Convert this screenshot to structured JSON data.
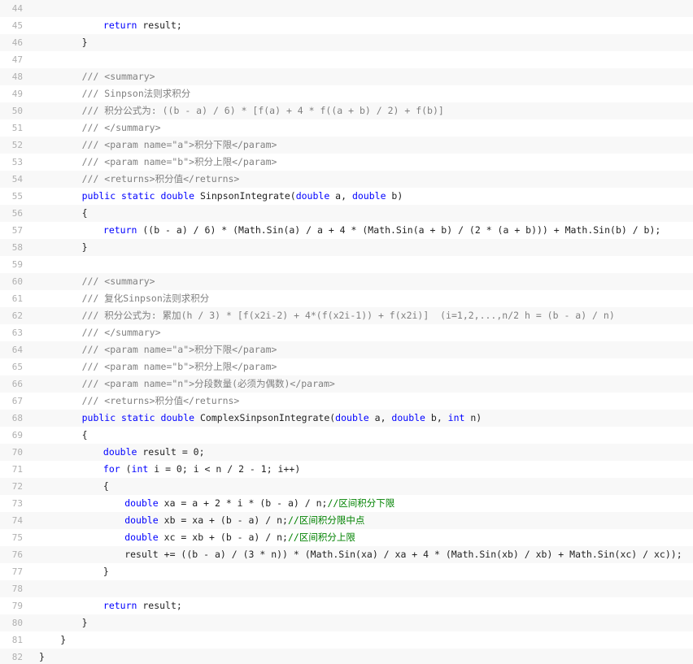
{
  "editor": {
    "colors": {
      "gutter_border": "#6ce26c",
      "line_number": "#afafaf",
      "keyword": "#0000ff",
      "xml_comment": "#808080",
      "line_comment": "#008200",
      "alt_row": "#f8f8f8"
    },
    "lines": [
      {
        "n": "44",
        "indent": 0,
        "segs": []
      },
      {
        "n": "45",
        "indent": 3,
        "segs": [
          {
            "t": "kw",
            "v": "return"
          },
          {
            "t": "p",
            "v": " result;"
          }
        ]
      },
      {
        "n": "46",
        "indent": 2,
        "segs": [
          {
            "t": "p",
            "v": "}"
          }
        ]
      },
      {
        "n": "47",
        "indent": 0,
        "segs": []
      },
      {
        "n": "48",
        "indent": 2,
        "segs": [
          {
            "t": "cm",
            "v": "/// <summary>"
          }
        ]
      },
      {
        "n": "49",
        "indent": 2,
        "segs": [
          {
            "t": "cm",
            "v": "/// Sinpson法则求积分"
          }
        ]
      },
      {
        "n": "50",
        "indent": 2,
        "segs": [
          {
            "t": "cm",
            "v": "/// 积分公式为: ((b - a) / 6) * [f(a) + 4 * f((a + b) / 2) + f(b)]"
          }
        ]
      },
      {
        "n": "51",
        "indent": 2,
        "segs": [
          {
            "t": "cm",
            "v": "/// </summary>"
          }
        ]
      },
      {
        "n": "52",
        "indent": 2,
        "segs": [
          {
            "t": "cm",
            "v": "/// <param name=\"a\">积分下限</param>"
          }
        ]
      },
      {
        "n": "53",
        "indent": 2,
        "segs": [
          {
            "t": "cm",
            "v": "/// <param name=\"b\">积分上限</param>"
          }
        ]
      },
      {
        "n": "54",
        "indent": 2,
        "segs": [
          {
            "t": "cm",
            "v": "/// <returns>积分值</returns>"
          }
        ]
      },
      {
        "n": "55",
        "indent": 2,
        "segs": [
          {
            "t": "kw",
            "v": "public static double"
          },
          {
            "t": "p",
            "v": " SinpsonIntegrate("
          },
          {
            "t": "kw",
            "v": "double"
          },
          {
            "t": "p",
            "v": " a, "
          },
          {
            "t": "kw",
            "v": "double"
          },
          {
            "t": "p",
            "v": " b)"
          }
        ]
      },
      {
        "n": "56",
        "indent": 2,
        "segs": [
          {
            "t": "p",
            "v": "{"
          }
        ]
      },
      {
        "n": "57",
        "indent": 3,
        "segs": [
          {
            "t": "kw",
            "v": "return"
          },
          {
            "t": "p",
            "v": " ((b - a) / 6) * (Math.Sin(a) / a + 4 * (Math.Sin(a + b) / (2 * (a + b))) + Math.Sin(b) / b);"
          }
        ]
      },
      {
        "n": "58",
        "indent": 2,
        "segs": [
          {
            "t": "p",
            "v": "}"
          }
        ]
      },
      {
        "n": "59",
        "indent": 0,
        "segs": []
      },
      {
        "n": "60",
        "indent": 2,
        "segs": [
          {
            "t": "cm",
            "v": "/// <summary>"
          }
        ]
      },
      {
        "n": "61",
        "indent": 2,
        "segs": [
          {
            "t": "cm",
            "v": "/// 复化Sinpson法则求积分"
          }
        ]
      },
      {
        "n": "62",
        "indent": 2,
        "segs": [
          {
            "t": "cm",
            "v": "/// 积分公式为: 累加(h / 3) * [f(x2i-2) + 4*(f(x2i-1)) + f(x2i)]  (i=1,2,...,n/2 h = (b - a) / n)"
          }
        ]
      },
      {
        "n": "63",
        "indent": 2,
        "segs": [
          {
            "t": "cm",
            "v": "/// </summary>"
          }
        ]
      },
      {
        "n": "64",
        "indent": 2,
        "segs": [
          {
            "t": "cm",
            "v": "/// <param name=\"a\">积分下限</param>"
          }
        ]
      },
      {
        "n": "65",
        "indent": 2,
        "segs": [
          {
            "t": "cm",
            "v": "/// <param name=\"b\">积分上限</param>"
          }
        ]
      },
      {
        "n": "66",
        "indent": 2,
        "segs": [
          {
            "t": "cm",
            "v": "/// <param name=\"n\">分段数量(必须为偶数)</param>"
          }
        ]
      },
      {
        "n": "67",
        "indent": 2,
        "segs": [
          {
            "t": "cm",
            "v": "/// <returns>积分值</returns>"
          }
        ]
      },
      {
        "n": "68",
        "indent": 2,
        "segs": [
          {
            "t": "kw",
            "v": "public static double"
          },
          {
            "t": "p",
            "v": " ComplexSinpsonIntegrate("
          },
          {
            "t": "kw",
            "v": "double"
          },
          {
            "t": "p",
            "v": " a, "
          },
          {
            "t": "kw",
            "v": "double"
          },
          {
            "t": "p",
            "v": " b, "
          },
          {
            "t": "kw",
            "v": "int"
          },
          {
            "t": "p",
            "v": " n)"
          }
        ]
      },
      {
        "n": "69",
        "indent": 2,
        "segs": [
          {
            "t": "p",
            "v": "{"
          }
        ]
      },
      {
        "n": "70",
        "indent": 3,
        "segs": [
          {
            "t": "kw",
            "v": "double"
          },
          {
            "t": "p",
            "v": " result = 0;"
          }
        ]
      },
      {
        "n": "71",
        "indent": 3,
        "segs": [
          {
            "t": "kw",
            "v": "for"
          },
          {
            "t": "p",
            "v": " ("
          },
          {
            "t": "kw",
            "v": "int"
          },
          {
            "t": "p",
            "v": " i = 0; i < n / 2 - 1; i++)"
          }
        ]
      },
      {
        "n": "72",
        "indent": 3,
        "segs": [
          {
            "t": "p",
            "v": "{"
          }
        ]
      },
      {
        "n": "73",
        "indent": 4,
        "segs": [
          {
            "t": "kw",
            "v": "double"
          },
          {
            "t": "p",
            "v": " xa = a + 2 * i * (b - a) / n;"
          },
          {
            "t": "gc",
            "v": "//区间积分下限"
          }
        ]
      },
      {
        "n": "74",
        "indent": 4,
        "segs": [
          {
            "t": "kw",
            "v": "double"
          },
          {
            "t": "p",
            "v": " xb = xa + (b - a) / n;"
          },
          {
            "t": "gc",
            "v": "//区间积分限中点"
          }
        ]
      },
      {
        "n": "75",
        "indent": 4,
        "segs": [
          {
            "t": "kw",
            "v": "double"
          },
          {
            "t": "p",
            "v": " xc = xb + (b - a) / n;"
          },
          {
            "t": "gc",
            "v": "//区间积分上限"
          }
        ]
      },
      {
        "n": "76",
        "indent": 4,
        "segs": [
          {
            "t": "p",
            "v": "result += ((b - a) / (3 * n)) * (Math.Sin(xa) / xa + 4 * (Math.Sin(xb) / xb) + Math.Sin(xc) / xc));"
          }
        ]
      },
      {
        "n": "77",
        "indent": 3,
        "segs": [
          {
            "t": "p",
            "v": "}"
          }
        ]
      },
      {
        "n": "78",
        "indent": 0,
        "segs": []
      },
      {
        "n": "79",
        "indent": 3,
        "segs": [
          {
            "t": "kw",
            "v": "return"
          },
          {
            "t": "p",
            "v": " result;"
          }
        ]
      },
      {
        "n": "80",
        "indent": 2,
        "segs": [
          {
            "t": "p",
            "v": "}"
          }
        ]
      },
      {
        "n": "81",
        "indent": 1,
        "segs": [
          {
            "t": "p",
            "v": "}"
          }
        ]
      },
      {
        "n": "82",
        "indent": 0,
        "segs": [
          {
            "t": "p",
            "v": "}"
          }
        ]
      }
    ]
  }
}
